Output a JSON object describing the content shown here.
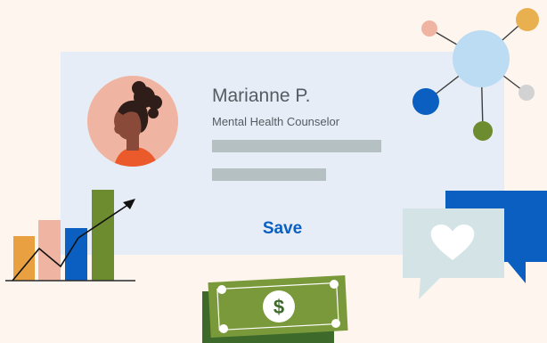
{
  "profile": {
    "name": "Marianne P.",
    "title": "Mental Health Counselor"
  },
  "actions": {
    "save_label": "Save"
  },
  "money": {
    "symbol": "$"
  },
  "colors": {
    "background": "#fdf5ee",
    "card": "#e6edf7",
    "accent_blue": "#0a5fc0",
    "placeholder": "#b5c0c2",
    "green": "#6d8b2f",
    "peach": "#f0b4a2",
    "orange": "#e8a040"
  },
  "icons": [
    "avatar-illustration",
    "network-graph-icon",
    "growth-chart-icon",
    "heart-chat-icon",
    "dollar-bill-icon"
  ]
}
